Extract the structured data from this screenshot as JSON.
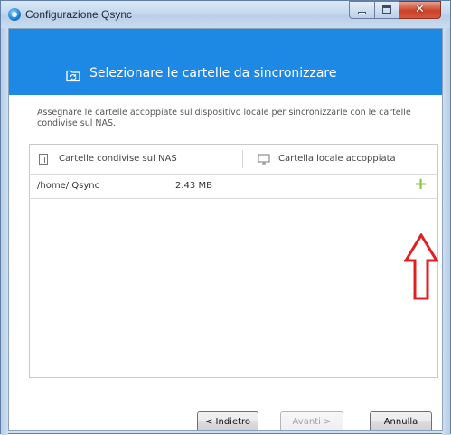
{
  "window": {
    "title": "Configurazione Qsync",
    "icon": "qsync-app-icon"
  },
  "banner": {
    "icon": "folder-sync-icon",
    "title": "Selezionare le cartelle da sincronizzare",
    "background": "#1e88e5"
  },
  "description": "Assegnare le cartelle accoppiate sul dispositivo locale per sincronizzarle con le cartelle condivise sul NAS.",
  "table": {
    "columns": [
      {
        "icon": "nas-icon",
        "label": "Cartelle condivise sul NAS"
      },
      {
        "icon": "monitor-icon",
        "label": "Cartella locale accoppiata"
      }
    ],
    "rows": [
      {
        "name": "/home/.Qsync",
        "size": "2.43 MB",
        "action_icon": "plus-icon"
      }
    ]
  },
  "annotation": {
    "icon": "up-arrow-outline-icon",
    "color": "#e02020"
  },
  "footer": {
    "back_label": "< Indietro",
    "next_label": "Avanti >",
    "cancel_label": "Annulla"
  },
  "colors": {
    "accent": "#1e88e5",
    "add_icon": "#8bc34a"
  }
}
